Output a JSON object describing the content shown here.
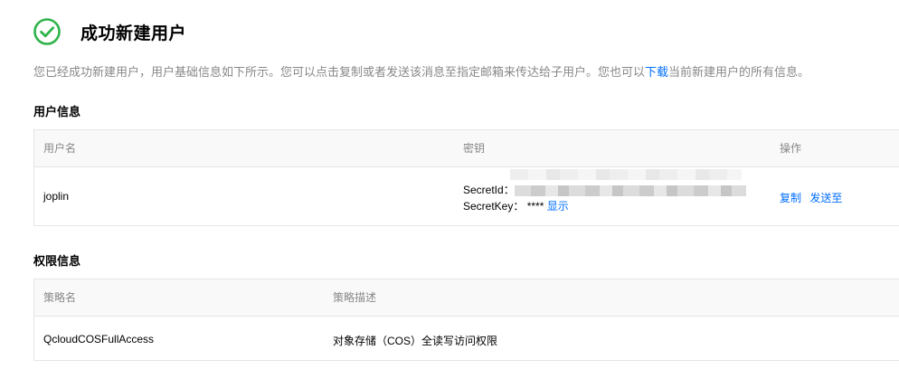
{
  "header": {
    "title": "成功新建用户",
    "icon": "check-circle-icon",
    "icon_color": "#2eb34a"
  },
  "description": {
    "prefix": "您已经成功新建用户，用户基础信息如下所示。您可以点击复制或者发送该消息至指定邮箱来传达给子用户。您也可以",
    "link": "下载",
    "suffix": "当前新建用户的所有信息。"
  },
  "user_info": {
    "section_title": "用户信息",
    "columns": {
      "username": "用户名",
      "key": "密钥",
      "actions": "操作"
    },
    "row": {
      "username": "joplin",
      "secret_id_label": "SecretId：",
      "secret_key_label": "SecretKey：",
      "secret_key_mask": "****",
      "show_link": "显示",
      "copy_link": "复制",
      "send_link": "发送至"
    }
  },
  "permission_info": {
    "section_title": "权限信息",
    "columns": {
      "policy_name": "策略名",
      "policy_desc": "策略描述"
    },
    "row": {
      "policy_name": "QcloudCOSFullAccess",
      "policy_desc": "对象存储（COS）全读写访问权限"
    }
  },
  "colors": {
    "link": "#006eff",
    "muted_text": "#888888",
    "border": "#e5e5e5",
    "header_bg": "#f9f9f9"
  }
}
